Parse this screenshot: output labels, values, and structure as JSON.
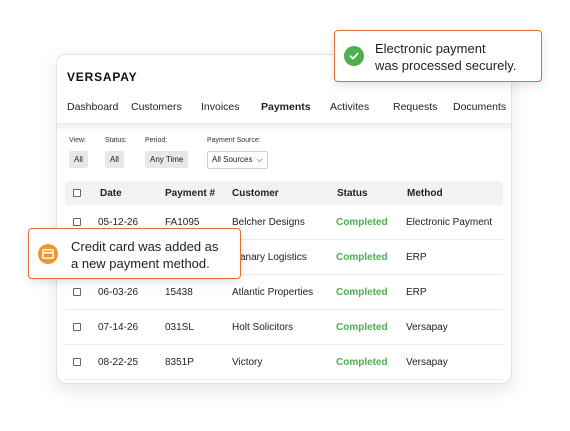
{
  "app": {
    "logo": "VERSAPAY"
  },
  "nav": {
    "items": [
      "Dashboard",
      "Customers",
      "Invoices",
      "Payments",
      "Activites",
      "Requests",
      "Documents"
    ],
    "active": "Payments"
  },
  "filters": {
    "view": {
      "label": "View:",
      "value": "All"
    },
    "status": {
      "label": "Status:",
      "value": "All"
    },
    "period": {
      "label": "Period:",
      "value": "Any Time"
    },
    "source": {
      "label": "Payment Source:",
      "value": "All Sources"
    }
  },
  "table": {
    "headers": [
      "Date",
      "Payment #",
      "Customer",
      "Status",
      "Method"
    ],
    "rows": [
      {
        "date": "05-12-26",
        "payment": "FA1095",
        "customer": "Belcher Designs",
        "status": "Completed",
        "method": "Electronic Payment"
      },
      {
        "date": "",
        "payment": "",
        "customer": "anary Logistics",
        "status": "Completed",
        "method": "ERP"
      },
      {
        "date": "06-03-26",
        "payment": "15438",
        "customer": "Atlantic Properties",
        "status": "Completed",
        "method": "ERP"
      },
      {
        "date": "07-14-26",
        "payment": "031SL",
        "customer": "Holt Solicitors",
        "status": "Completed",
        "method": "Versapay"
      },
      {
        "date": "08-22-25",
        "payment": "8351P",
        "customer": "Victory",
        "status": "Completed",
        "method": "Versapay"
      }
    ]
  },
  "toasts": {
    "payment": {
      "line1": "Electronic payment",
      "line2": "was processed securely.",
      "icon": "check-circle-icon"
    },
    "card": {
      "line1": "Credit card was added as",
      "line2": "a new payment method.",
      "icon": "credit-card-icon"
    }
  },
  "colors": {
    "accent": "#e0703a",
    "success": "#4caf50",
    "card_icon": "#f0962f"
  }
}
